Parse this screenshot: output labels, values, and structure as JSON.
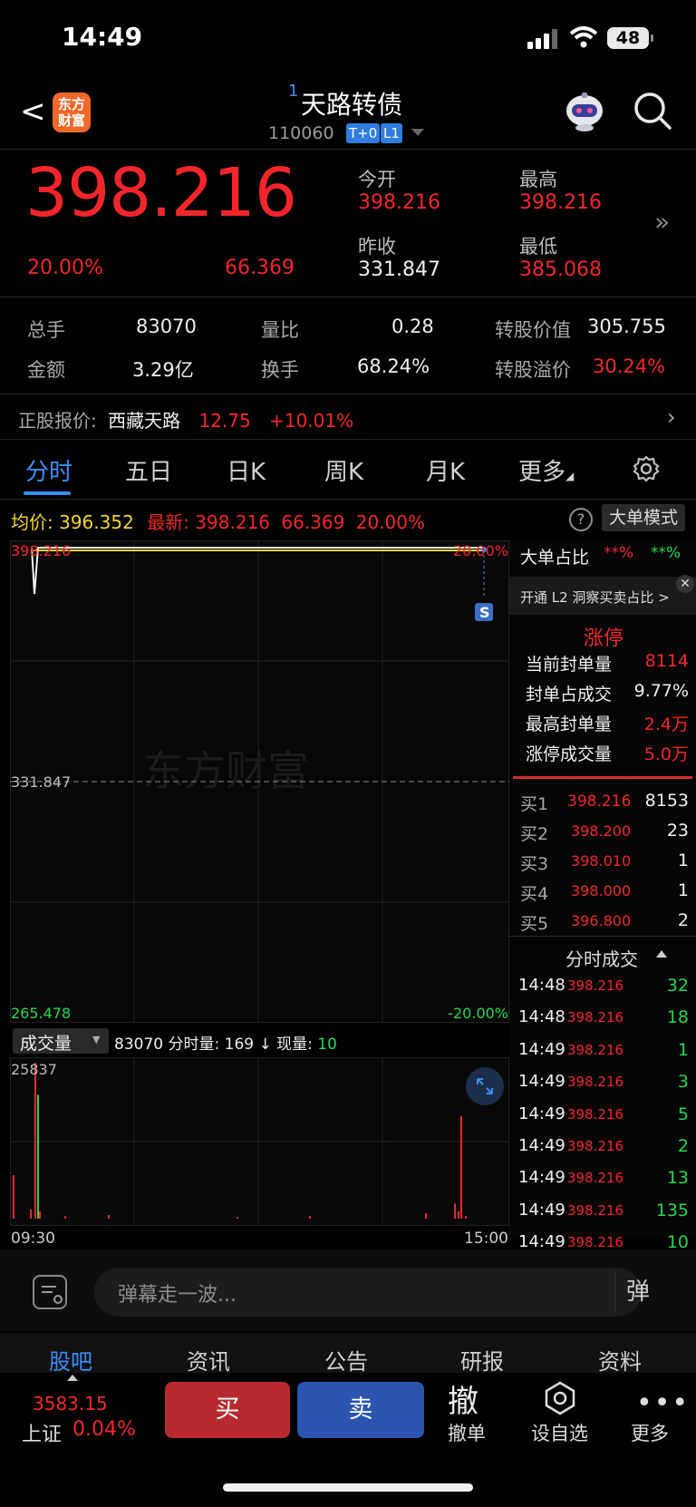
{
  "status_bar": {
    "time": "14:49",
    "battery": "48"
  },
  "header": {
    "back": "<",
    "logo": "东方财富",
    "title_prefix": "1",
    "title": "天路转债",
    "code": "110060",
    "tags": [
      "T+0",
      "L1"
    ]
  },
  "quote": {
    "price": "398.216",
    "pct": "20.00%",
    "change": "66.369",
    "open_label": "今开",
    "open": "398.216",
    "high_label": "最高",
    "high": "398.216",
    "prev_label": "昨收",
    "prev": "331.847",
    "low_label": "最低",
    "low": "385.068"
  },
  "stats": [
    {
      "label": "总手",
      "value": "83070"
    },
    {
      "label": "量比",
      "value": "0.28"
    },
    {
      "label": "转股价值",
      "value": "305.755"
    },
    {
      "label": "金额",
      "value": "3.29亿"
    },
    {
      "label": "换手",
      "value": "68.24%"
    },
    {
      "label": "转股溢价",
      "value": "30.24%"
    }
  ],
  "underlying": {
    "label": "正股报价:",
    "name": "西藏天路",
    "price": "12.75",
    "pct": "+10.01%"
  },
  "tabs": [
    "分时",
    "五日",
    "日K",
    "周K",
    "月K",
    "更多"
  ],
  "avg_bar": {
    "avg_label": "均价:",
    "avg": "396.352",
    "latest_label": "最新:",
    "latest": "398.216",
    "chg": "66.369",
    "pct": "20.00%",
    "mode": "大单模式"
  },
  "chart_labels": {
    "top_price": "398.216",
    "top_pct": "20.00%",
    "mid_price": "331.847",
    "bottom_price": "265.478",
    "bottom_pct": "-20.00%",
    "watermark": "东方财富",
    "marker": "S"
  },
  "volume_bar": {
    "selector": "成交量",
    "total": "83070",
    "fs_label": "分时量:",
    "fs_value": "169",
    "arrow": "↓",
    "now_label": "现量:",
    "now_value": "10"
  },
  "volume_axis": {
    "max": "25837",
    "start": "09:30",
    "end": "15:00"
  },
  "chart_data": {
    "type": "bar",
    "title": "",
    "ylim": [
      0,
      25837
    ],
    "x": [
      "09:30",
      "09:31",
      "09:32",
      "09:33",
      "09:34",
      "09:40",
      "10:00",
      "11:00",
      "14:00",
      "14:40",
      "14:46",
      "14:47",
      "14:48",
      "14:49"
    ],
    "values": [
      7200,
      1500,
      25837,
      20500,
      1200,
      400,
      600,
      300,
      400,
      900,
      2500,
      1200,
      17000,
      400
    ],
    "price_line": {
      "ylim": [
        265.478,
        398.216
      ],
      "baseline": 331.847,
      "points": [
        398.216,
        385.068,
        398.216,
        398.216
      ]
    }
  },
  "big_order": {
    "label": "大单占比",
    "v1": "**%",
    "v2": "**%",
    "promo": "开通 L2 洞察买卖占比 >"
  },
  "limit_up": {
    "title": "涨停",
    "rows": [
      {
        "label": "当前封单量",
        "value": "8114"
      },
      {
        "label": "封单占成交",
        "value": "9.77%"
      },
      {
        "label": "最高封单量",
        "value": "2.4万"
      },
      {
        "label": "涨停成交量",
        "value": "5.0万"
      }
    ]
  },
  "order_book": [
    {
      "label": "买1",
      "price": "398.216",
      "vol": "8153"
    },
    {
      "label": "买2",
      "price": "398.200",
      "vol": "23"
    },
    {
      "label": "买3",
      "price": "398.010",
      "vol": "1"
    },
    {
      "label": "买4",
      "price": "398.000",
      "vol": "1"
    },
    {
      "label": "买5",
      "price": "396.800",
      "vol": "2"
    }
  ],
  "ticks_title": "分时成交",
  "ticks": [
    {
      "time": "14:48",
      "price": "398.216",
      "vol": "32"
    },
    {
      "time": "14:48",
      "price": "398.216",
      "vol": "18"
    },
    {
      "time": "14:49",
      "price": "398.216",
      "vol": "1"
    },
    {
      "time": "14:49",
      "price": "398.216",
      "vol": "3"
    },
    {
      "time": "14:49",
      "price": "398.216",
      "vol": "5"
    },
    {
      "time": "14:49",
      "price": "398.216",
      "vol": "2"
    },
    {
      "time": "14:49",
      "price": "398.216",
      "vol": "13"
    },
    {
      "time": "14:49",
      "price": "398.216",
      "vol": "135"
    },
    {
      "time": "14:49",
      "price": "398.216",
      "vol": "10"
    }
  ],
  "danmu": {
    "placeholder": "弹幕走一波...",
    "button": "弹"
  },
  "bottom_tabs": [
    "股吧",
    "资讯",
    "公告",
    "研报",
    "资料"
  ],
  "index": {
    "value": "3583.15",
    "name": "上证",
    "pct": "0.04%"
  },
  "actions": {
    "buy": "买",
    "sell": "卖",
    "cancel_big": "撤",
    "cancel": "撤单",
    "watch": "设自选",
    "more": "更多"
  },
  "colors": {
    "up": "#f2262a",
    "down": "#1fd94c",
    "accent": "#3a8ef5",
    "avg": "#f5d62b"
  }
}
